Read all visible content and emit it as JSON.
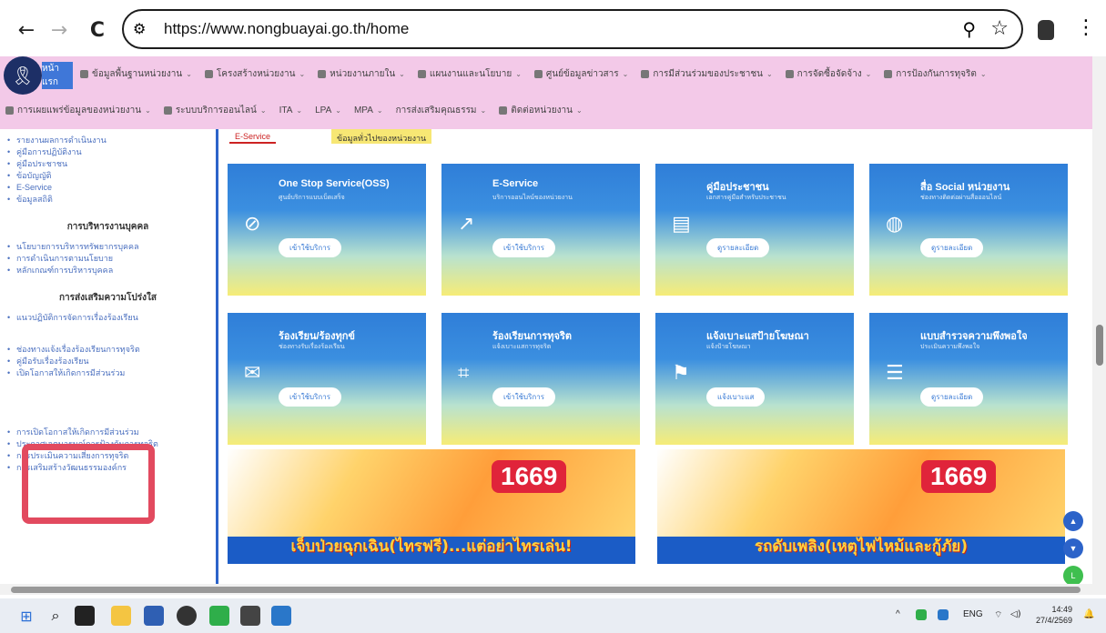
{
  "browser": {
    "back_icon": "←",
    "forward_icon": "→",
    "reload_icon": "C",
    "url": "https://www.nongbuayai.go.th/home",
    "tune_icon": "⚙",
    "zoom_icon": "⚲",
    "star_icon": "☆",
    "menu_icon": "⋮"
  },
  "nav": {
    "home_label": "หน้าแรก",
    "row1": [
      "ข้อมูลพื้นฐานหน่วยงาน",
      "โครงสร้างหน่วยงาน",
      "หน่วยงานภายใน",
      "แผนงานและนโยบาย",
      "ศูนย์ข้อมูลข่าวสาร",
      "การมีส่วนร่วมของประชาชน",
      "การจัดซื้อจัดจ้าง",
      "การป้องกันการทุจริต"
    ],
    "row2": [
      "การเผยแพร่ข้อมูลของหน่วยงาน",
      "ระบบบริการออนไลน์",
      "ITA",
      "LPA",
      "MPA",
      "การส่งเสริมคุณธรรม",
      "ติดต่อหน่วยงาน"
    ]
  },
  "sidebar": {
    "group1": [
      "รายงานผลการดำเนินงาน",
      "คู่มือการปฏิบัติงาน",
      "คู่มือประชาชน",
      "ข้อบัญญัติ",
      "E-Service",
      "ข้อมูลสถิติ"
    ],
    "head2": "การบริหารงานบุคคล",
    "group2": [
      "นโยบายการบริหารทรัพยากรบุคคล",
      "การดำเนินการตามนโยบาย",
      "หลักเกณฑ์การบริหารบุคคล"
    ],
    "head3": "การส่งเสริมความโปร่งใส",
    "group3": [
      "แนวปฏิบัติการจัดการเรื่องร้องเรียน",
      "ช่องทางแจ้งเรื่องร้องเรียนการทุจริต",
      "คู่มือรับเรื่องร้องเรียน",
      "เปิดโอกาสให้เกิดการมีส่วนร่วม"
    ],
    "group4": [
      "การเปิดโอกาสให้เกิดการมีส่วนร่วม",
      "ประกาศเจตนารมณ์การป้องกันการทุจริต",
      "การประเมินความเสี่ยงการทุจริต",
      "การเสริมสร้างวัฒนธรรมองค์กร"
    ]
  },
  "tabs": {
    "tab1": "E-Service",
    "tab2": "ข้อมูลทั่วไปของหน่วยงาน"
  },
  "cards": [
    {
      "title": "One Stop Service(OSS)",
      "desc": "ศูนย์บริการแบบเบ็ดเสร็จ",
      "button": "เข้าใช้บริการ",
      "icon": "⊘"
    },
    {
      "title": "E-Service",
      "desc": "บริการออนไลน์ของหน่วยงาน",
      "button": "เข้าใช้บริการ",
      "icon": "↗"
    },
    {
      "title": "คู่มือประชาชน",
      "desc": "เอกสารคู่มือสำหรับประชาชน",
      "button": "ดูรายละเอียด",
      "icon": "▤"
    },
    {
      "title": "สื่อ Social หน่วยงาน",
      "desc": "ช่องทางติดต่อผ่านสื่อออนไลน์",
      "button": "ดูรายละเอียด",
      "icon": "◍"
    },
    {
      "title": "ร้องเรียน/ร้องทุกข์",
      "desc": "ช่องทางรับเรื่องร้องเรียน",
      "button": "เข้าใช้บริการ",
      "icon": "✉"
    },
    {
      "title": "ร้องเรียนการทุจริต",
      "desc": "แจ้งเบาะแสการทุจริต",
      "button": "เข้าใช้บริการ",
      "icon": "⌗"
    },
    {
      "title": "แจ้งเบาะแสป้ายโฆษณา",
      "desc": "แจ้งป้ายโฆษณา",
      "button": "แจ้งเบาะแส",
      "icon": "⚑"
    },
    {
      "title": "แบบสำรวจความพึงพอใจ",
      "desc": "ประเมินความพึงพอใจ",
      "button": "ดูรายละเอียด",
      "icon": "☰"
    }
  ],
  "banners": [
    {
      "number": "1669",
      "caption": "เจ็บป่วยฉุกเฉิน(ไทรฟรี)...แต่อย่าไทรเล่น!"
    },
    {
      "number": "1669",
      "caption": "รถดับเพลิง(เหตุไฟไหม้และกู้ภัย)"
    }
  ],
  "taskbar": {
    "start_icon": "⊞",
    "search_icon": "⌕",
    "lang": "ENG",
    "wifi_icon": "⌔",
    "sound_icon": "◁)",
    "time": "14:49",
    "date": "27/4/2569"
  },
  "colors": {
    "nav_bg": "#f3c9e8",
    "card_top": "#2f7ed8",
    "card_bottom": "#f6ec77",
    "sidebar_rule": "#2c63c9",
    "highlight_box": "#e24a5f"
  }
}
